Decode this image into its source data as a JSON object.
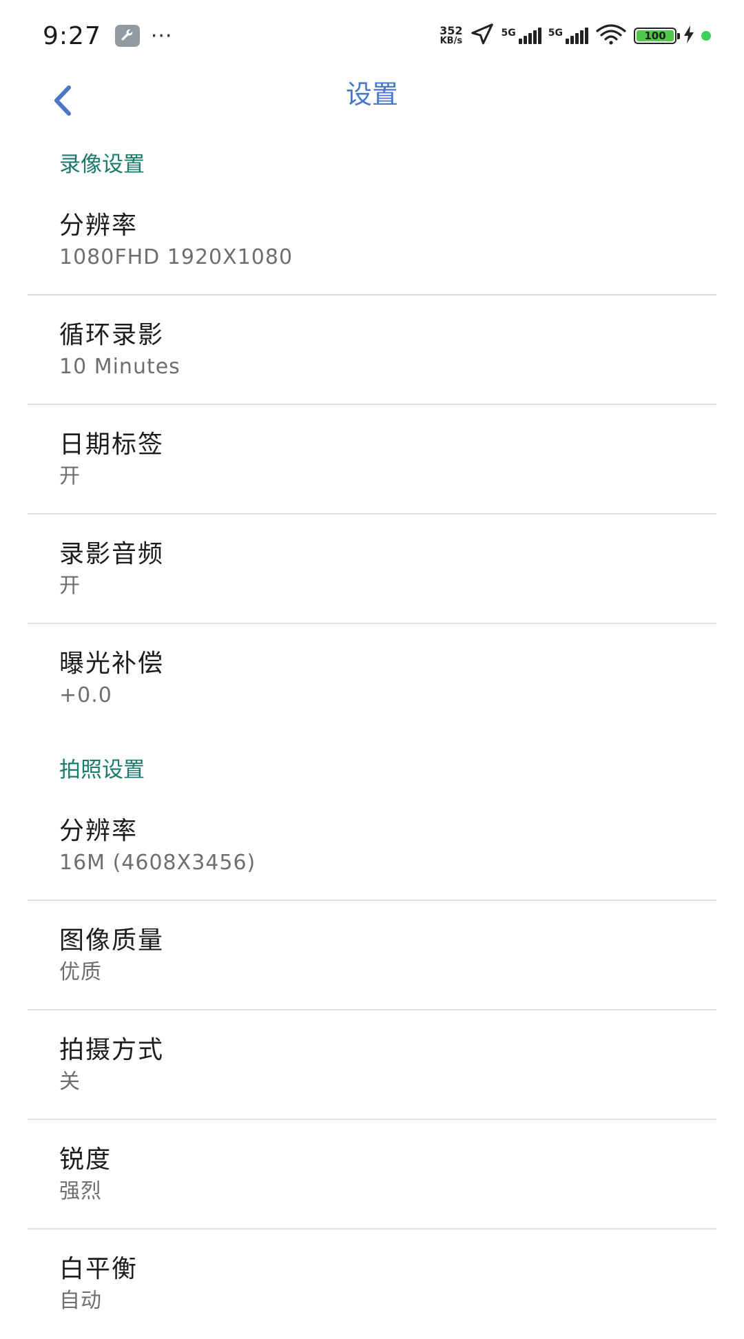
{
  "status_bar": {
    "time": "9:27",
    "more": "···",
    "net_speed_value": "352",
    "net_speed_unit": "KB/s",
    "signal1_label": "5G",
    "signal2_label": "5G",
    "battery_level": "100",
    "battery_color": "#4fc94a",
    "icons": [
      "wrench-icon",
      "location-arrow-icon",
      "signal-icon",
      "wifi-icon",
      "battery-icon",
      "charging-bolt-icon"
    ]
  },
  "app_bar": {
    "title": "设置",
    "accent_color": "#4a78c8"
  },
  "sections": [
    {
      "header": "录像设置",
      "items": [
        {
          "title": "分辨率",
          "value": "1080FHD 1920X1080"
        },
        {
          "title": "循环录影",
          "value": "10 Minutes"
        },
        {
          "title": "日期标签",
          "value": "开"
        },
        {
          "title": "录影音频",
          "value": "开"
        },
        {
          "title": "曝光补偿",
          "value": "+0.0"
        }
      ]
    },
    {
      "header": "拍照设置",
      "items": [
        {
          "title": "分辨率",
          "value": "16M (4608X3456)"
        },
        {
          "title": "图像质量",
          "value": "优质"
        },
        {
          "title": "拍摄方式",
          "value": "关"
        },
        {
          "title": "锐度",
          "value": "强烈"
        },
        {
          "title": "白平衡",
          "value": "自动"
        }
      ]
    }
  ],
  "colors": {
    "section_header": "#1b7a6c",
    "divider": "#e1e1e1"
  }
}
